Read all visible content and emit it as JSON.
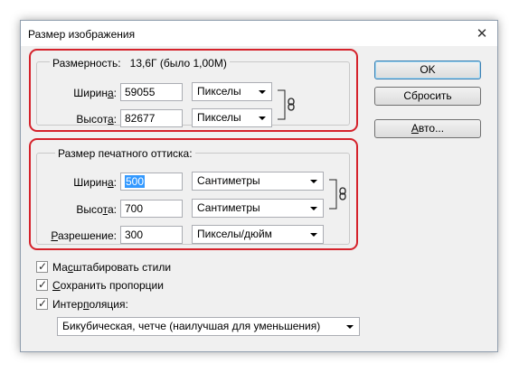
{
  "window": {
    "title": "Размер изображения",
    "close_glyph": "✕"
  },
  "pixel_dims": {
    "legend_label": "Размерность:",
    "legend_value": "13,6Г (было 1,00М)",
    "width": {
      "label_pre": "Ширин",
      "label_ul": "а",
      "label_post": ":",
      "value": "59055",
      "unit": "Пикселы"
    },
    "height": {
      "label_pre": "Высот",
      "label_ul": "а",
      "label_post": ":",
      "value": "82677",
      "unit": "Пикселы"
    }
  },
  "doc_size": {
    "legend": "Размер печатного оттиска:",
    "width": {
      "label_pre": "Ширин",
      "label_ul": "а",
      "label_post": ":",
      "value": "500",
      "unit": "Сантиметры"
    },
    "height": {
      "label_pre": "Высо",
      "label_ul": "т",
      "label_post": "а:",
      "value": "700",
      "unit": "Сантиметры"
    },
    "resolution": {
      "label_pre": "",
      "label_ul": "Р",
      "label_post": "азрешение:",
      "value": "300",
      "unit": "Пикселы/дюйм"
    }
  },
  "buttons": {
    "ok": "OK",
    "reset": "Сбросить",
    "auto_ul": "А",
    "auto_post": "вто..."
  },
  "options": {
    "scale_styles": {
      "pre": "Ма",
      "ul": "с",
      "post": "штабировать стили",
      "checked": true
    },
    "constrain": {
      "pre": "",
      "ul": "С",
      "post": "охранить пропорции",
      "checked": true
    },
    "resample": {
      "pre": "Интер",
      "ul": "п",
      "post": "оляция:",
      "checked": true
    },
    "resample_method": "Бикубическая, четче (наилучшая для уменьшения)"
  },
  "colors": {
    "highlight_border": "#d5222b",
    "selection": "#3399ff"
  },
  "icons": {
    "chain": "chain-link-icon",
    "check": "✓"
  }
}
